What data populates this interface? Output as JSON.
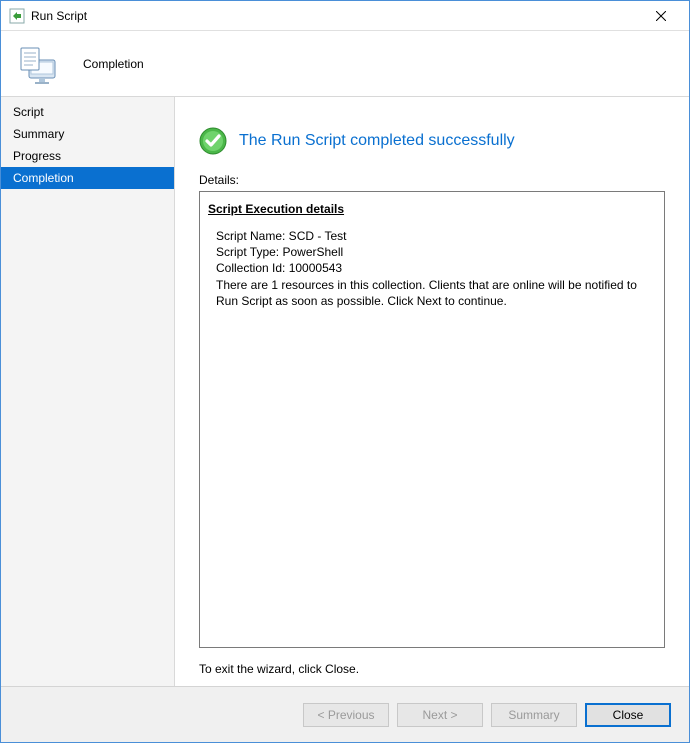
{
  "window": {
    "title": "Run Script"
  },
  "header": {
    "title": "Completion"
  },
  "sidebar": {
    "items": [
      {
        "label": "Script",
        "selected": false
      },
      {
        "label": "Summary",
        "selected": false
      },
      {
        "label": "Progress",
        "selected": false
      },
      {
        "label": "Completion",
        "selected": true
      }
    ]
  },
  "content": {
    "status_text": "The Run Script completed successfully",
    "details_label": "Details:",
    "details_heading": "Script Execution details",
    "script_name_line": "Script Name: SCD - Test",
    "script_type_line": "Script Type: PowerShell",
    "collection_id_line": "Collection Id: 10000543",
    "resources_line": "There are 1 resources in this collection. Clients that are online will be notified to Run Script as soon as possible. Click Next to continue.",
    "exit_hint": "To exit the wizard, click Close."
  },
  "footer": {
    "previous_label": "< Previous",
    "next_label": "Next >",
    "summary_label": "Summary",
    "close_label": "Close"
  }
}
